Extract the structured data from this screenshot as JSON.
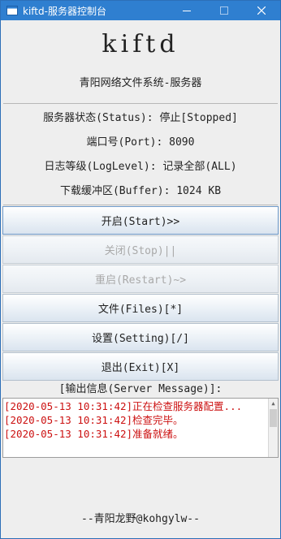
{
  "window": {
    "title": "kiftd-服务器控制台",
    "minimize_icon": "minimize-icon",
    "maximize_icon": "maximize-icon",
    "close_icon": "close-icon",
    "titlebar_color": "#2f7fd0"
  },
  "header": {
    "logo": "kiftd",
    "subtitle": "青阳网络文件系统-服务器"
  },
  "status": {
    "server_status": "服务器状态(Status): 停止[Stopped]",
    "port": "端口号(Port): 8090",
    "log_level": "日志等级(LogLevel): 记录全部(ALL)",
    "buffer": "下载缓冲区(Buffer): 1024 KB"
  },
  "buttons": {
    "start": "开启(Start)>>",
    "stop": "关闭(Stop)||",
    "restart": "重启(Restart)~>",
    "files": "文件(Files)[*]",
    "setting": "设置(Setting)[/]",
    "exit": "退出(Exit)[X]"
  },
  "messages": {
    "label": "[输出信息(Server Message)]:",
    "lines": [
      "[2020-05-13 10:31:42]正在检查服务器配置...",
      "[2020-05-13 10:31:42]检查完毕。",
      "[2020-05-13 10:31:42]准备就绪。"
    ],
    "text_color": "#cc1111"
  },
  "footer": {
    "credit": "--青阳龙野@kohgylw--"
  }
}
